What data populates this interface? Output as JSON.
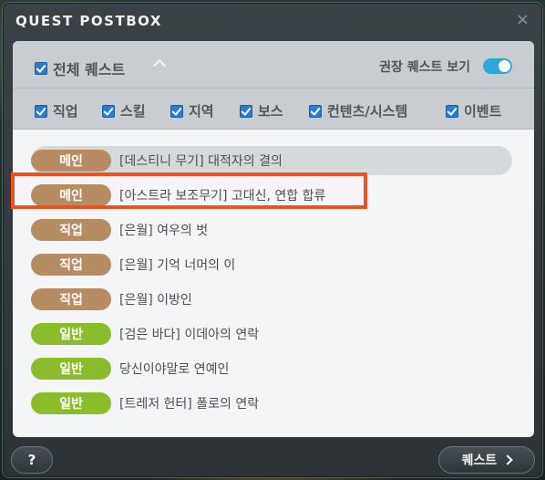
{
  "window": {
    "title": "QUEST POSTBOX",
    "close_glyph": "×"
  },
  "filters": {
    "all_label": "전체 퀘스트",
    "recommended_label": "권장 퀘스트 보기",
    "recommended_on": true,
    "categories": [
      {
        "label": "직업",
        "checked": true
      },
      {
        "label": "스킬",
        "checked": true
      },
      {
        "label": "지역",
        "checked": true
      },
      {
        "label": "보스",
        "checked": true
      },
      {
        "label": "컨텐츠/시스템",
        "checked": true
      },
      {
        "label": "이벤트",
        "checked": true
      }
    ]
  },
  "quests": [
    {
      "type": "메인",
      "title": "[데스티니 무기] 대적자의 결의"
    },
    {
      "type": "메인",
      "title": "[아스트라 보조무기] 고대신, 연합 합류"
    },
    {
      "type": "직업",
      "title": "[은월] 여우의 벗"
    },
    {
      "type": "직업",
      "title": "[은월] 기억 너머의 이"
    },
    {
      "type": "직업",
      "title": "[은월] 이방인"
    },
    {
      "type": "일반",
      "title": "[검은 바다] 이데아의 연락"
    },
    {
      "type": "일반",
      "title": "당신이야말로 연예인"
    },
    {
      "type": "일반",
      "title": "[트레저 헌터] 폴로의 연락"
    }
  ],
  "footer": {
    "help_label": "?",
    "quest_label": "퀘스트"
  },
  "colors": {
    "badge_main": "#b88c63",
    "badge_normal": "#8cbc2b",
    "highlight": "#f04e23",
    "toggle": "#2ea6d8"
  }
}
